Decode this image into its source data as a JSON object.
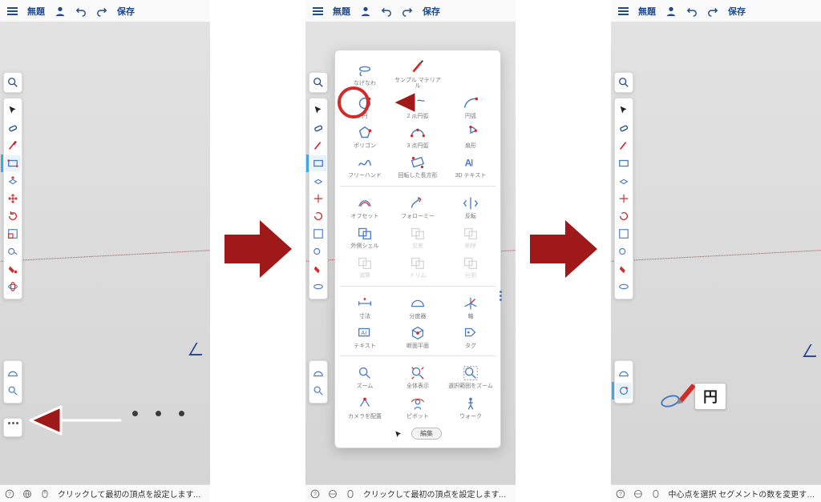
{
  "topbar": {
    "title": "無題",
    "save_label": "保存"
  },
  "sidebar_tools": [
    {
      "name": "select",
      "label": "選択",
      "color": "black"
    },
    {
      "name": "eraser",
      "label": "消しゴム",
      "color": "blue"
    },
    {
      "name": "line",
      "label": "線",
      "color": "red"
    },
    {
      "name": "rectangle",
      "label": "長方形",
      "color": "blue",
      "active_in": [
        1,
        2
      ]
    },
    {
      "name": "pushpull",
      "label": "プッシュ/プル",
      "color": "blue"
    },
    {
      "name": "move",
      "label": "移動",
      "color": "red"
    },
    {
      "name": "rotate",
      "label": "回転",
      "color": "red"
    },
    {
      "name": "scale",
      "label": "尺度",
      "color": "blue"
    },
    {
      "name": "tape",
      "label": "メジャー",
      "color": "blue"
    },
    {
      "name": "paint",
      "label": "ペイント",
      "color": "red"
    },
    {
      "name": "orbit",
      "label": "オービット",
      "color": "blue"
    }
  ],
  "sidebar_extra": [
    {
      "name": "protractor",
      "label": "分度器"
    },
    {
      "name": "zoom",
      "label": "ズーム"
    }
  ],
  "sidebar_bottom": {
    "more_label": "その他"
  },
  "status": {
    "hint_draw": "クリックして最初の頂点を設定します。 | Op",
    "hint_circle": "中心点を選択 セグメントの数を変更するには"
  },
  "palette": {
    "rows": [
      [
        {
          "name": "lasso",
          "label": "なげなわ"
        },
        {
          "name": "sample-material",
          "label": "サンプル マテリアル"
        },
        null
      ],
      [
        {
          "name": "circle",
          "label": "円",
          "highlight": true
        },
        {
          "name": "two-point-arc",
          "label": "2 点円弧"
        },
        {
          "name": "arc",
          "label": "円弧"
        }
      ],
      [
        {
          "name": "polygon",
          "label": "ポリゴン"
        },
        {
          "name": "three-point-arc",
          "label": "3 点円弧"
        },
        {
          "name": "pie",
          "label": "扇形"
        }
      ],
      [
        {
          "name": "freehand",
          "label": "フリーハンド"
        },
        {
          "name": "rotated-rect",
          "label": "回転した長方形"
        },
        {
          "name": "3d-text",
          "label": "3D テキスト"
        }
      ]
    ],
    "rows2": [
      [
        {
          "name": "offset",
          "label": "オフセット"
        },
        {
          "name": "followme",
          "label": "フォローミー"
        },
        {
          "name": "flip",
          "label": "反転"
        }
      ],
      [
        {
          "name": "outer-shell",
          "label": "外側シェル"
        },
        {
          "name": "union",
          "label": "交差",
          "disabled": true
        },
        {
          "name": "subtract",
          "label": "削除",
          "disabled": true
        }
      ],
      [
        {
          "name": "intersect",
          "label": "減算",
          "disabled": true
        },
        {
          "name": "trim",
          "label": "トリム",
          "disabled": true
        },
        {
          "name": "split",
          "label": "分割",
          "disabled": true
        }
      ]
    ],
    "rows3": [
      [
        {
          "name": "dimension",
          "label": "寸法"
        },
        {
          "name": "protractor2",
          "label": "分度器"
        },
        {
          "name": "axes",
          "label": "軸"
        }
      ],
      [
        {
          "name": "text",
          "label": "テキスト"
        },
        {
          "name": "section",
          "label": "断面平面"
        },
        {
          "name": "tag",
          "label": "タグ"
        }
      ]
    ],
    "rows4": [
      [
        {
          "name": "zoom2",
          "label": "ズーム"
        },
        {
          "name": "zoom-extents",
          "label": "全体表示"
        },
        {
          "name": "zoom-selection",
          "label": "選択範囲をズーム"
        }
      ],
      [
        {
          "name": "position-camera",
          "label": "カメラを配置"
        },
        {
          "name": "look-around",
          "label": "ピボット"
        },
        {
          "name": "walk",
          "label": "ウォーク"
        }
      ]
    ],
    "reset_label": "編集",
    "tooltip_circle": "円"
  }
}
